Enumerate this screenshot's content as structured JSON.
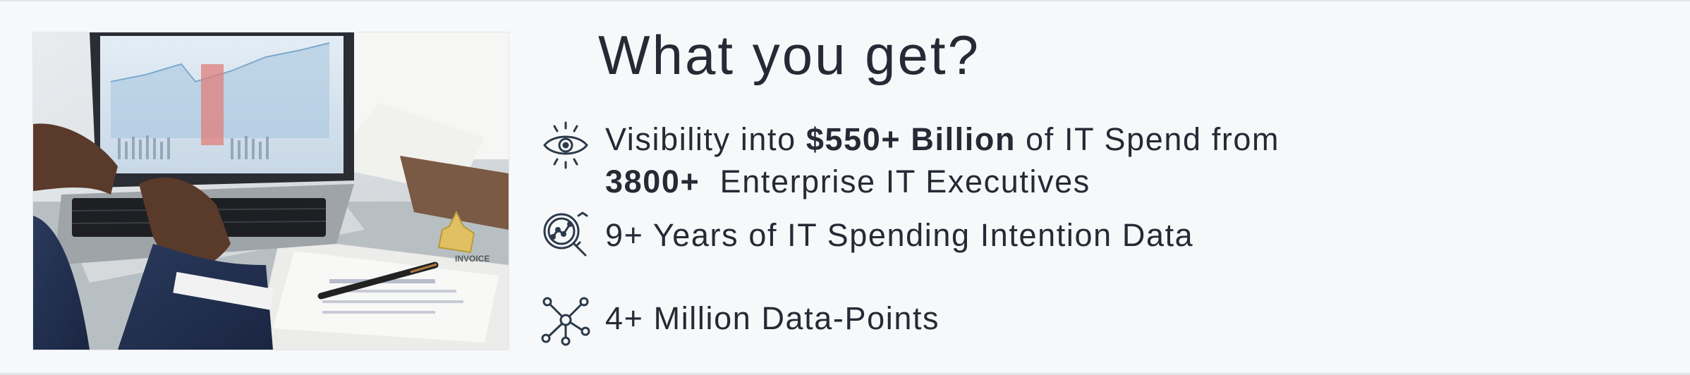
{
  "section": {
    "title": "What you get?"
  },
  "photo": {
    "description_icon": "laptop-analytics-photo",
    "invoice_text": "INVOICE"
  },
  "features": [
    {
      "icon": "eye-icon",
      "prefix": "Visibility into ",
      "highlight": "$550+ Billion",
      "suffix": " of IT Spend from",
      "line2_highlight": "3800+",
      "line2_suffix": "  Enterprise IT Executives"
    },
    {
      "icon": "magnifier-chart-icon",
      "text": "9+ Years of IT Spending Intention Data"
    },
    {
      "icon": "network-nodes-icon",
      "text": "4+ Million Data-Points"
    }
  ],
  "colors": {
    "text": "#262a35",
    "icon": "#2b3a4a",
    "background": "#f7f8fa"
  }
}
